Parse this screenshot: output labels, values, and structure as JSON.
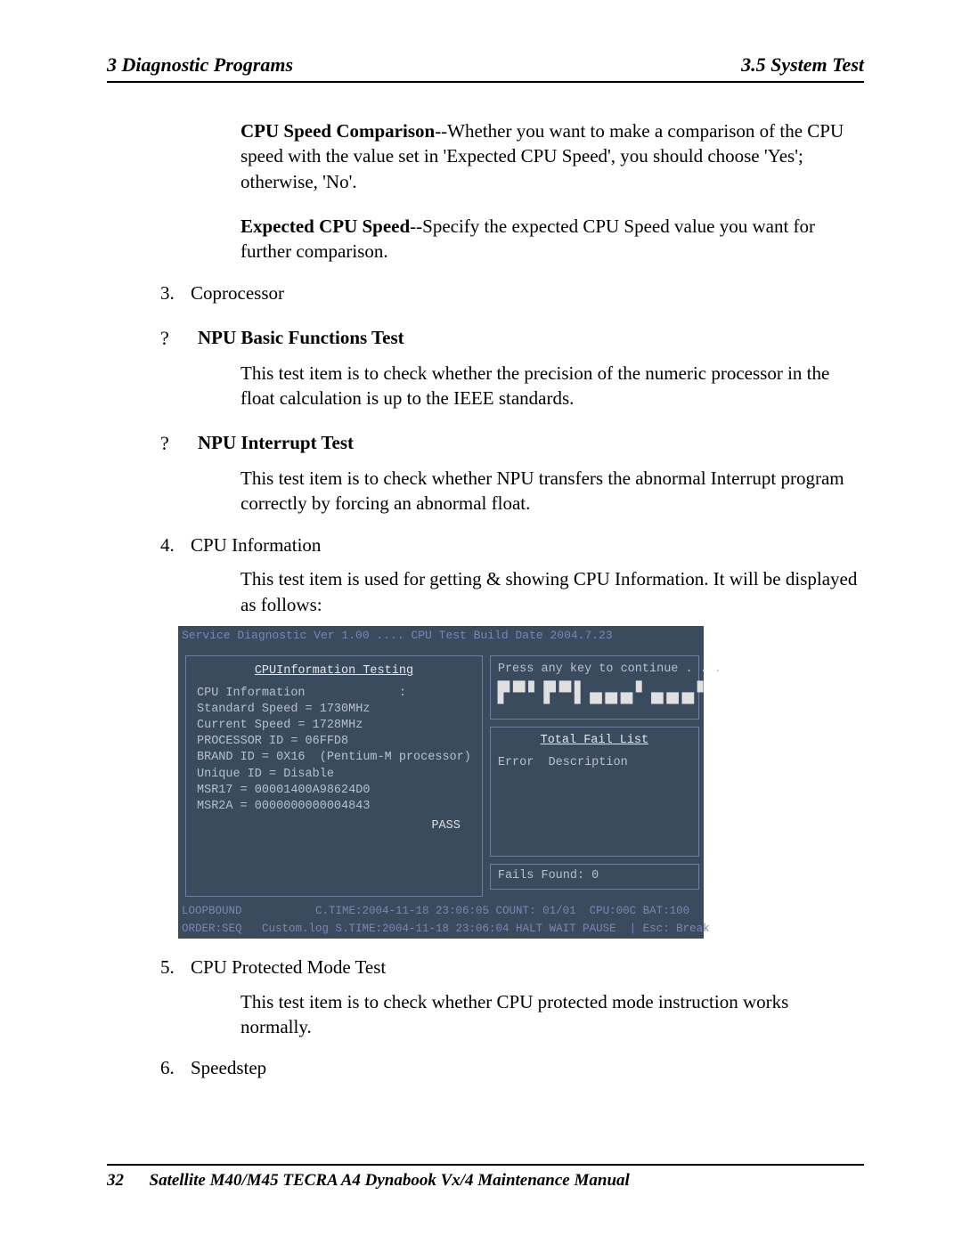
{
  "header": {
    "left": "3  Diagnostic Programs",
    "right": "3.5 System Test"
  },
  "paragraphs": {
    "cpu_speed_comp_label": "CPU Speed Comparison",
    "cpu_speed_comp_text": "--Whether you want to make a comparison of the CPU speed with the value set in 'Expected CPU Speed', you should choose 'Yes'; otherwise, 'No'.",
    "expected_cpu_speed_label": "Expected CPU Speed",
    "expected_cpu_speed_text": "--Specify the expected CPU Speed value you want for further comparison.",
    "item3_num": "3.",
    "item3_label": "Coprocessor",
    "npu_basic_title": "NPU Basic Functions Test",
    "npu_basic_desc": "This test item is to check whether the precision of the numeric processor in the float calculation is up to the IEEE standards.",
    "npu_int_title": "NPU Interrupt Test",
    "npu_int_desc": "This test item is to check whether NPU transfers the abnormal Interrupt program correctly by forcing an abnormal float.",
    "item4_num": "4.",
    "item4_label": "CPU Information",
    "item4_desc": "This test item is used for getting & showing CPU Information. It will be displayed as follows:",
    "item5_num": "5.",
    "item5_label": "CPU Protected Mode Test",
    "item5_desc": "This test item is to check whether CPU protected mode instruction works normally.",
    "item6_num": "6.",
    "item6_label": " Speedstep"
  },
  "bullet_glyph": "?",
  "terminal": {
    "titlebar": "Service Diagnostic Ver 1.00 ....  CPU Test   Build Date 2004.7.23",
    "left_title": "CPUInformation Testing",
    "left_lines": [
      "CPU Information             :",
      "Standard Speed = 1730MHz",
      "Current Speed = 1728MHz",
      "PROCESSOR ID = 06FFD8",
      "BRAND ID = 0X16  (Pentium-M processor)",
      "Unique ID = Disable",
      "MSR17 = 00001400A98624D0",
      "MSR2A = 0000000000004843"
    ],
    "left_pass": "PASS",
    "right_continue": "Press any key to continue . . .",
    "right_big": "▛▀▘▛▀▌▄▄▄▘▄▄▄▘",
    "fail_title": "Total Fail List",
    "fail_header": "Error  Description",
    "fails_found": "Fails Found: 0",
    "footer1": "LOOPBOUND           C.TIME:2004-11-18 23:06:05 COUNT: 01/01  CPU:00C BAT:100",
    "footer2": "ORDER:SEQ   Custom.log S.TIME:2004-11-18 23:06:04 HALT WAIT PAUSE  | Esc: Break"
  },
  "footer": {
    "pageno": "32",
    "title": "Satellite M40/M45 TECRA A4 Dynabook Vx/4  Maintenance Manual"
  }
}
